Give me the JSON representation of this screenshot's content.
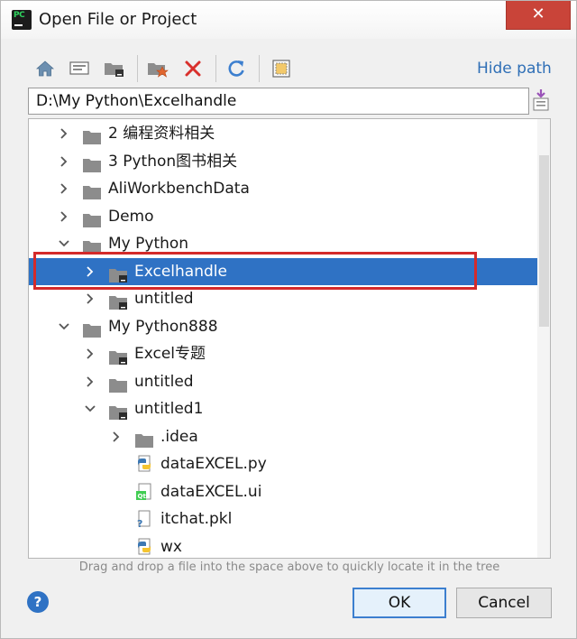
{
  "window": {
    "title": "Open File or Project",
    "close_glyph": "✕"
  },
  "app_icon": {
    "text": "PC"
  },
  "toolbar": {
    "buttons": [
      "home-icon",
      "desktop-icon",
      "project-icon",
      "new-folder-icon",
      "delete-icon",
      "refresh-icon",
      "show-hidden-icon"
    ],
    "hide_path_label": "Hide path"
  },
  "path": {
    "value": "D:\\My Python\\Excelhandle"
  },
  "tree": {
    "rows": [
      {
        "label": "2 编程资料相关",
        "indent": 0,
        "expander": "collapsed",
        "icon": "folder"
      },
      {
        "label": "3 Python图书相关",
        "indent": 0,
        "expander": "collapsed",
        "icon": "folder"
      },
      {
        "label": "AliWorkbenchData",
        "indent": 0,
        "expander": "collapsed",
        "icon": "folder"
      },
      {
        "label": "Demo",
        "indent": 0,
        "expander": "collapsed",
        "icon": "folder"
      },
      {
        "label": "My Python",
        "indent": 0,
        "expander": "expanded",
        "icon": "folder"
      },
      {
        "label": "Excelhandle",
        "indent": 1,
        "expander": "collapsed",
        "icon": "project-folder",
        "selected": true
      },
      {
        "label": "untitled",
        "indent": 1,
        "expander": "collapsed",
        "icon": "project-folder"
      },
      {
        "label": "My Python888",
        "indent": 0,
        "expander": "expanded",
        "icon": "folder"
      },
      {
        "label": "Excel专题",
        "indent": 1,
        "expander": "collapsed",
        "icon": "project-folder"
      },
      {
        "label": "untitled",
        "indent": 1,
        "expander": "collapsed",
        "icon": "folder"
      },
      {
        "label": "untitled1",
        "indent": 1,
        "expander": "expanded",
        "icon": "project-folder"
      },
      {
        "label": ".idea",
        "indent": 2,
        "expander": "collapsed",
        "icon": "folder"
      },
      {
        "label": "dataEXCEL.py",
        "indent": 2,
        "expander": "none",
        "icon": "python-file"
      },
      {
        "label": "dataEXCEL.ui",
        "indent": 2,
        "expander": "none",
        "icon": "qt-file"
      },
      {
        "label": "itchat.pkl",
        "indent": 2,
        "expander": "none",
        "icon": "unknown-file"
      },
      {
        "label": "wx",
        "indent": 2,
        "expander": "none",
        "icon": "python-file"
      }
    ]
  },
  "hint": "Drag and drop a file into the space above to quickly locate it in the tree",
  "help_label": "?",
  "buttons": {
    "ok": "OK",
    "cancel": "Cancel"
  },
  "colors": {
    "selection": "#2f72c4",
    "highlight_box": "#d42a2a",
    "link": "#2f6fb6"
  }
}
